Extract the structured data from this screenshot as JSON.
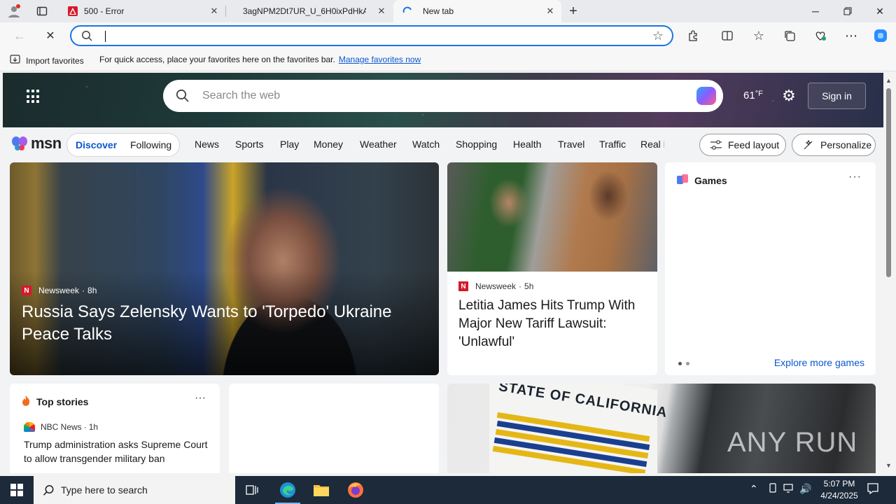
{
  "browser": {
    "tabs": [
      {
        "title": "500 - Error"
      },
      {
        "title": "3agNPM2Dt7UR_U_6H0ixPdHkAf"
      },
      {
        "title": "New tab"
      }
    ],
    "address": {
      "value": "",
      "placeholder": ""
    }
  },
  "favorites_bar": {
    "import_label": "Import favorites",
    "hint": "For quick access, place your favorites here on the favorites bar.",
    "manage_link": "Manage favorites now"
  },
  "msn": {
    "search_placeholder": "Search the web",
    "temperature": "61",
    "temp_unit": "°F",
    "sign_in": "Sign in",
    "logo": "msn",
    "tabs": [
      "Discover",
      "Following"
    ],
    "nav": [
      "News",
      "Sports",
      "Play",
      "Money",
      "Weather",
      "Watch",
      "Shopping",
      "Health",
      "Travel",
      "Traffic",
      "Real E"
    ],
    "feed_layout": "Feed layout",
    "personalize": "Personalize"
  },
  "lead_story": {
    "source": "Newsweek",
    "age": "8h",
    "title": "Russia Says Zelensky Wants to 'Torpedo' Ukraine Peace Talks"
  },
  "mid_story": {
    "source": "Newsweek",
    "age": "5h",
    "title": "Letitia James Hits Trump With Major New Tariff Lawsuit: 'Unlawful'"
  },
  "games": {
    "title": "Games",
    "explore": "Explore more games"
  },
  "top_stories": {
    "title": "Top stories",
    "source": "NBC News",
    "age": "1h",
    "headline": "Trump administration asks Supreme Court to allow transgender military ban"
  },
  "image_text": {
    "dmv_sign": "STATE OF CALIFORNIA",
    "watermark": "ANY RUN"
  },
  "taskbar": {
    "search_placeholder": "Type here to search",
    "time": "5:07 PM",
    "date": "4/24/2025"
  },
  "colors": {
    "accent": "#0b57d0",
    "newsweek": "#d6192b",
    "taskbar": "#1c2a3a"
  }
}
